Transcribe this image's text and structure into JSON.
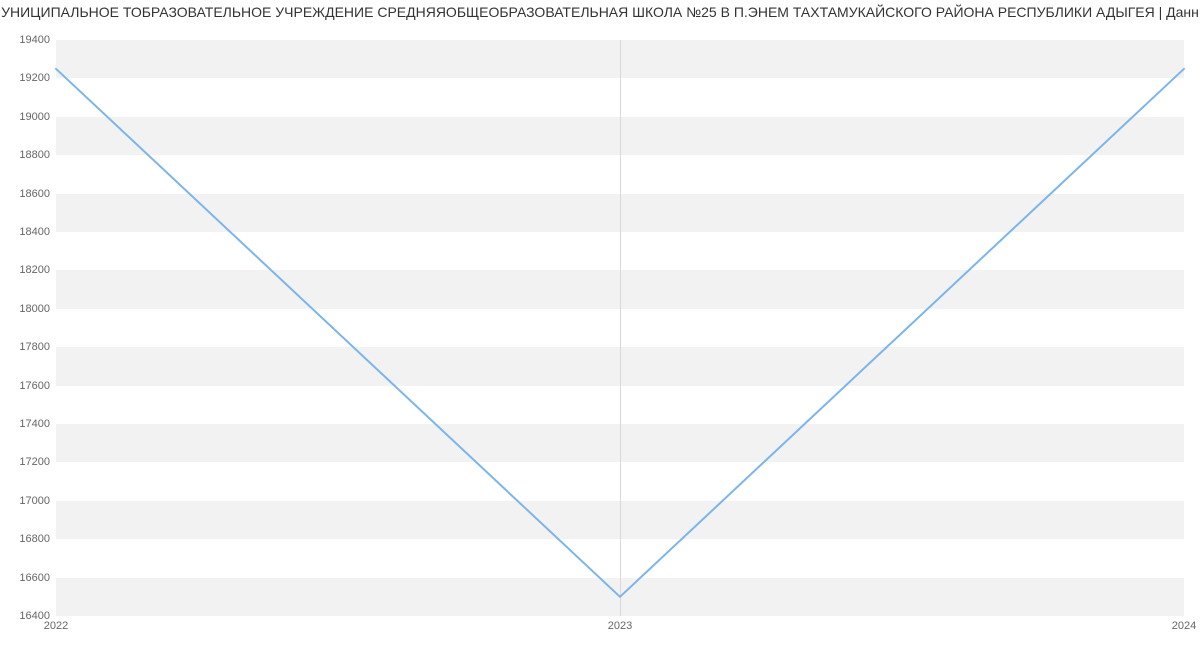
{
  "chart_data": {
    "type": "line",
    "title": "УНИЦИПАЛЬНОЕ ТОБРАЗОВАТЕЛЬНОЕ УЧРЕЖДЕНИЕ СРЕДНЯЯОБЩЕОБРАЗОВАТЕЛЬНАЯ ШКОЛА №25 В П.ЭНЕМ ТАХТАМУКАЙСКОГО РАЙОНА РЕСПУБЛИКИ АДЫГЕЯ | Данн",
    "x": [
      2022,
      2023,
      2024
    ],
    "y": [
      19250,
      16500,
      19250
    ],
    "xlabel": "",
    "ylabel": "",
    "xlim": [
      2022,
      2024
    ],
    "ylim": [
      16400,
      19400
    ],
    "yticks": [
      16400,
      16600,
      16800,
      17000,
      17200,
      17400,
      17600,
      17800,
      18000,
      18200,
      18400,
      18600,
      18800,
      19000,
      19200,
      19400
    ],
    "xticks": [
      2022,
      2023,
      2024
    ],
    "line_color": "#7cb5ec",
    "band_color": "#f2f2f2"
  }
}
